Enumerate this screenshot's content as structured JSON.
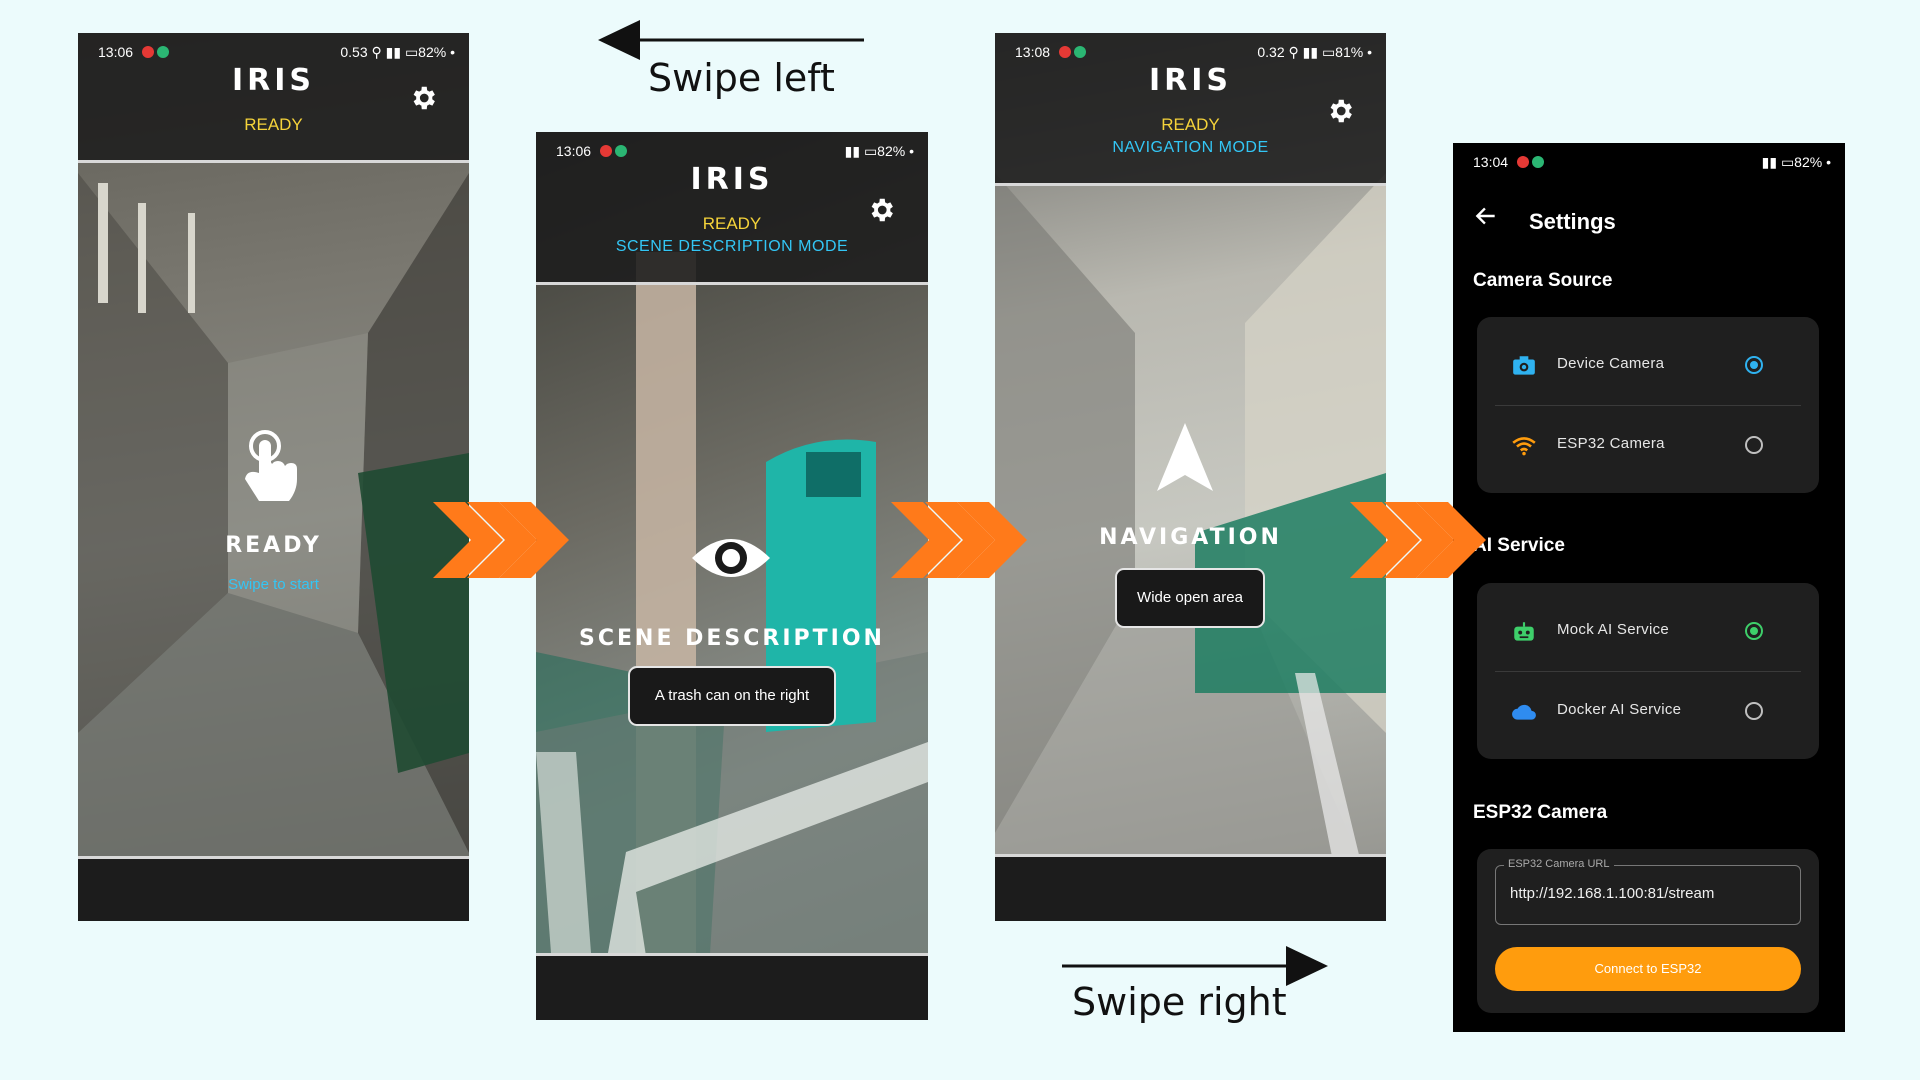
{
  "colors": {
    "background": "#ecfbfc",
    "accent_orange": "#ff7a1a",
    "ready_yellow": "#f5d33a",
    "mode_blue": "#33c6f5",
    "radio_camera": "#2fb2f0",
    "radio_ai": "#3ecf6a",
    "connect_button": "#ff9c0d"
  },
  "screen1": {
    "time": "13:06",
    "status_right": "0.53 ⚲ ▮▮ ▭82% •",
    "app_title": "IRIS",
    "status": "READY",
    "center_icon": "tap-hand-icon",
    "mode_label": "READY",
    "hint": "Swipe to start"
  },
  "screen2": {
    "time": "13:06",
    "status_right": "▮▮ ▭82% •",
    "app_title": "IRIS",
    "status": "READY",
    "mode": "SCENE DESCRIPTION MODE",
    "center_icon": "eye-icon",
    "mode_label": "SCENE DESCRIPTION",
    "caption": "A trash can on the right"
  },
  "screen3": {
    "time": "13:08",
    "status_right": "0.32 ⚲ ▮▮ ▭81% •",
    "app_title": "IRIS",
    "status": "READY",
    "mode": "NAVIGATION MODE",
    "center_icon": "navigation-arrow-icon",
    "mode_label": "NAVIGATION",
    "caption": "Wide open area"
  },
  "gestures": {
    "swipe_left": "Swipe left",
    "swipe_right": "Swipe right"
  },
  "settings": {
    "time": "13:04",
    "status_right": "▮▮ ▭82% •",
    "title": "Settings",
    "camera_section": "Camera Source",
    "camera_options": [
      {
        "label": "Device Camera",
        "icon": "camera-icon",
        "selected": true
      },
      {
        "label": "ESP32 Camera",
        "icon": "wifi-icon",
        "selected": false
      }
    ],
    "ai_section": "AI Service",
    "ai_options": [
      {
        "label": "Mock AI Service",
        "icon": "robot-icon",
        "selected": true
      },
      {
        "label": "Docker AI Service",
        "icon": "cloud-icon",
        "selected": false
      }
    ],
    "esp_section": "ESP32 Camera",
    "url_label": "ESP32 Camera URL",
    "url_value": "http://192.168.1.100:81/stream",
    "connect_label": "Connect to ESP32"
  }
}
